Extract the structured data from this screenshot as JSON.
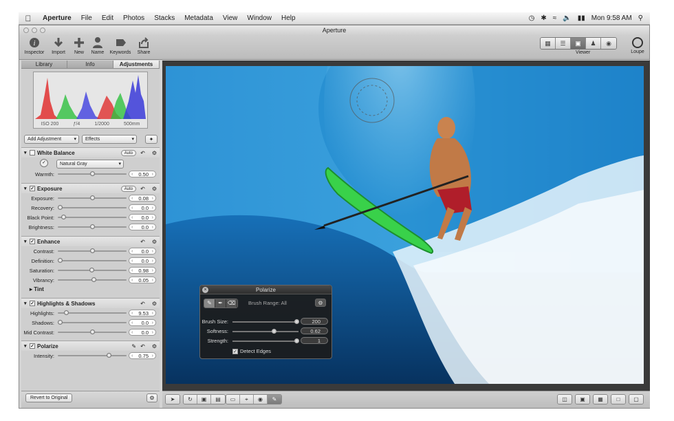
{
  "menubar": {
    "app": "Aperture",
    "items": [
      "File",
      "Edit",
      "Photos",
      "Stacks",
      "Metadata",
      "View",
      "Window",
      "Help"
    ],
    "clock": "Mon 9:58 AM"
  },
  "window": {
    "title": "Aperture"
  },
  "toolbar": {
    "inspector": "Inspector",
    "import": "Import",
    "new": "New",
    "name": "Name",
    "keywords": "Keywords",
    "share": "Share",
    "viewer": "Viewer",
    "loupe": "Loupe"
  },
  "sidebar": {
    "tabs": [
      "Library",
      "Info",
      "Adjustments"
    ],
    "active_tab": "Adjustments",
    "histogram_info": [
      "ISO 200",
      "ƒ/4",
      "1/2000",
      "500mm"
    ],
    "add_adjustment": "Add Adjustment",
    "effects": "Effects",
    "revert": "Revert to Original"
  },
  "bricks": {
    "white_balance": {
      "title": "White Balance",
      "auto": "Auto",
      "preset": "Natural Gray",
      "warmth_label": "Warmth:",
      "warmth": "0.50",
      "warmth_pct": 0.5
    },
    "exposure": {
      "title": "Exposure",
      "auto": "Auto",
      "rows": [
        {
          "label": "Exposure:",
          "value": "0.08",
          "pct": 0.5
        },
        {
          "label": "Recovery:",
          "value": "0.0",
          "pct": 0.0
        },
        {
          "label": "Black Point:",
          "value": "0.0",
          "pct": 0.05
        },
        {
          "label": "Brightness:",
          "value": "0.0",
          "pct": 0.5
        }
      ]
    },
    "enhance": {
      "title": "Enhance",
      "rows": [
        {
          "label": "Contrast:",
          "value": "0.0",
          "pct": 0.5
        },
        {
          "label": "Definition:",
          "value": "0.0",
          "pct": 0.0
        },
        {
          "label": "Saturation:",
          "value": "0.98",
          "pct": 0.49
        },
        {
          "label": "Vibrancy:",
          "value": "0.05",
          "pct": 0.52
        }
      ],
      "tint": "Tint"
    },
    "highlights_shadows": {
      "title": "Highlights & Shadows",
      "rows": [
        {
          "label": "Highlights:",
          "value": "9.53",
          "pct": 0.1
        },
        {
          "label": "Shadows:",
          "value": "0.0",
          "pct": 0.0
        },
        {
          "label": "Mid Contrast:",
          "value": "0.0",
          "pct": 0.5
        }
      ]
    },
    "polarize": {
      "title": "Polarize",
      "rows": [
        {
          "label": "Intensity:",
          "value": "0.75",
          "pct": 0.75
        }
      ]
    }
  },
  "hud": {
    "title": "Polarize",
    "brush_range": "Brush Range: All",
    "rows": [
      {
        "label": "Brush Size:",
        "value": "200",
        "pct": 0.98
      },
      {
        "label": "Softness:",
        "value": "0.62",
        "pct": 0.62
      },
      {
        "label": "Strength:",
        "value": "1",
        "pct": 0.98
      }
    ],
    "detect_edges": "Detect Edges"
  },
  "colors": {
    "sky": "#3a9fd8",
    "water": "#0c4f8a",
    "board": "#39d14a"
  }
}
